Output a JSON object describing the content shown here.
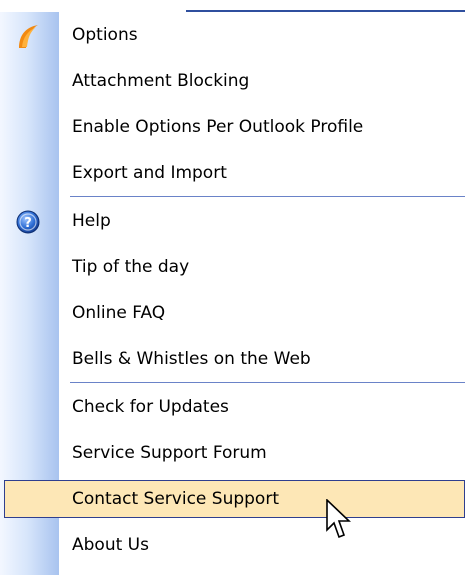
{
  "menu": {
    "items": [
      {
        "label": "Options",
        "icon": "app-logo-icon"
      },
      {
        "label": "Attachment Blocking"
      },
      {
        "label": "Enable Options Per Outlook Profile"
      },
      {
        "label": "Export and Import"
      },
      {
        "label": "Help",
        "icon": "help-icon"
      },
      {
        "label": "Tip of the day"
      },
      {
        "label": "Online FAQ"
      },
      {
        "label": "Bells & Whistles on the Web"
      },
      {
        "label": "Check for Updates"
      },
      {
        "label": "Service Support Forum"
      },
      {
        "label": "Contact Service Support",
        "state": "hovered"
      },
      {
        "label": "About Us"
      }
    ]
  },
  "colors": {
    "highlight_fill": "#fde7b6",
    "highlight_border": "#2f3f8f",
    "separator": "#6a83c8",
    "logo_orange": "#f28a12",
    "help_blue": "#1f5fc0"
  },
  "cursor": "arrow-cursor-icon"
}
